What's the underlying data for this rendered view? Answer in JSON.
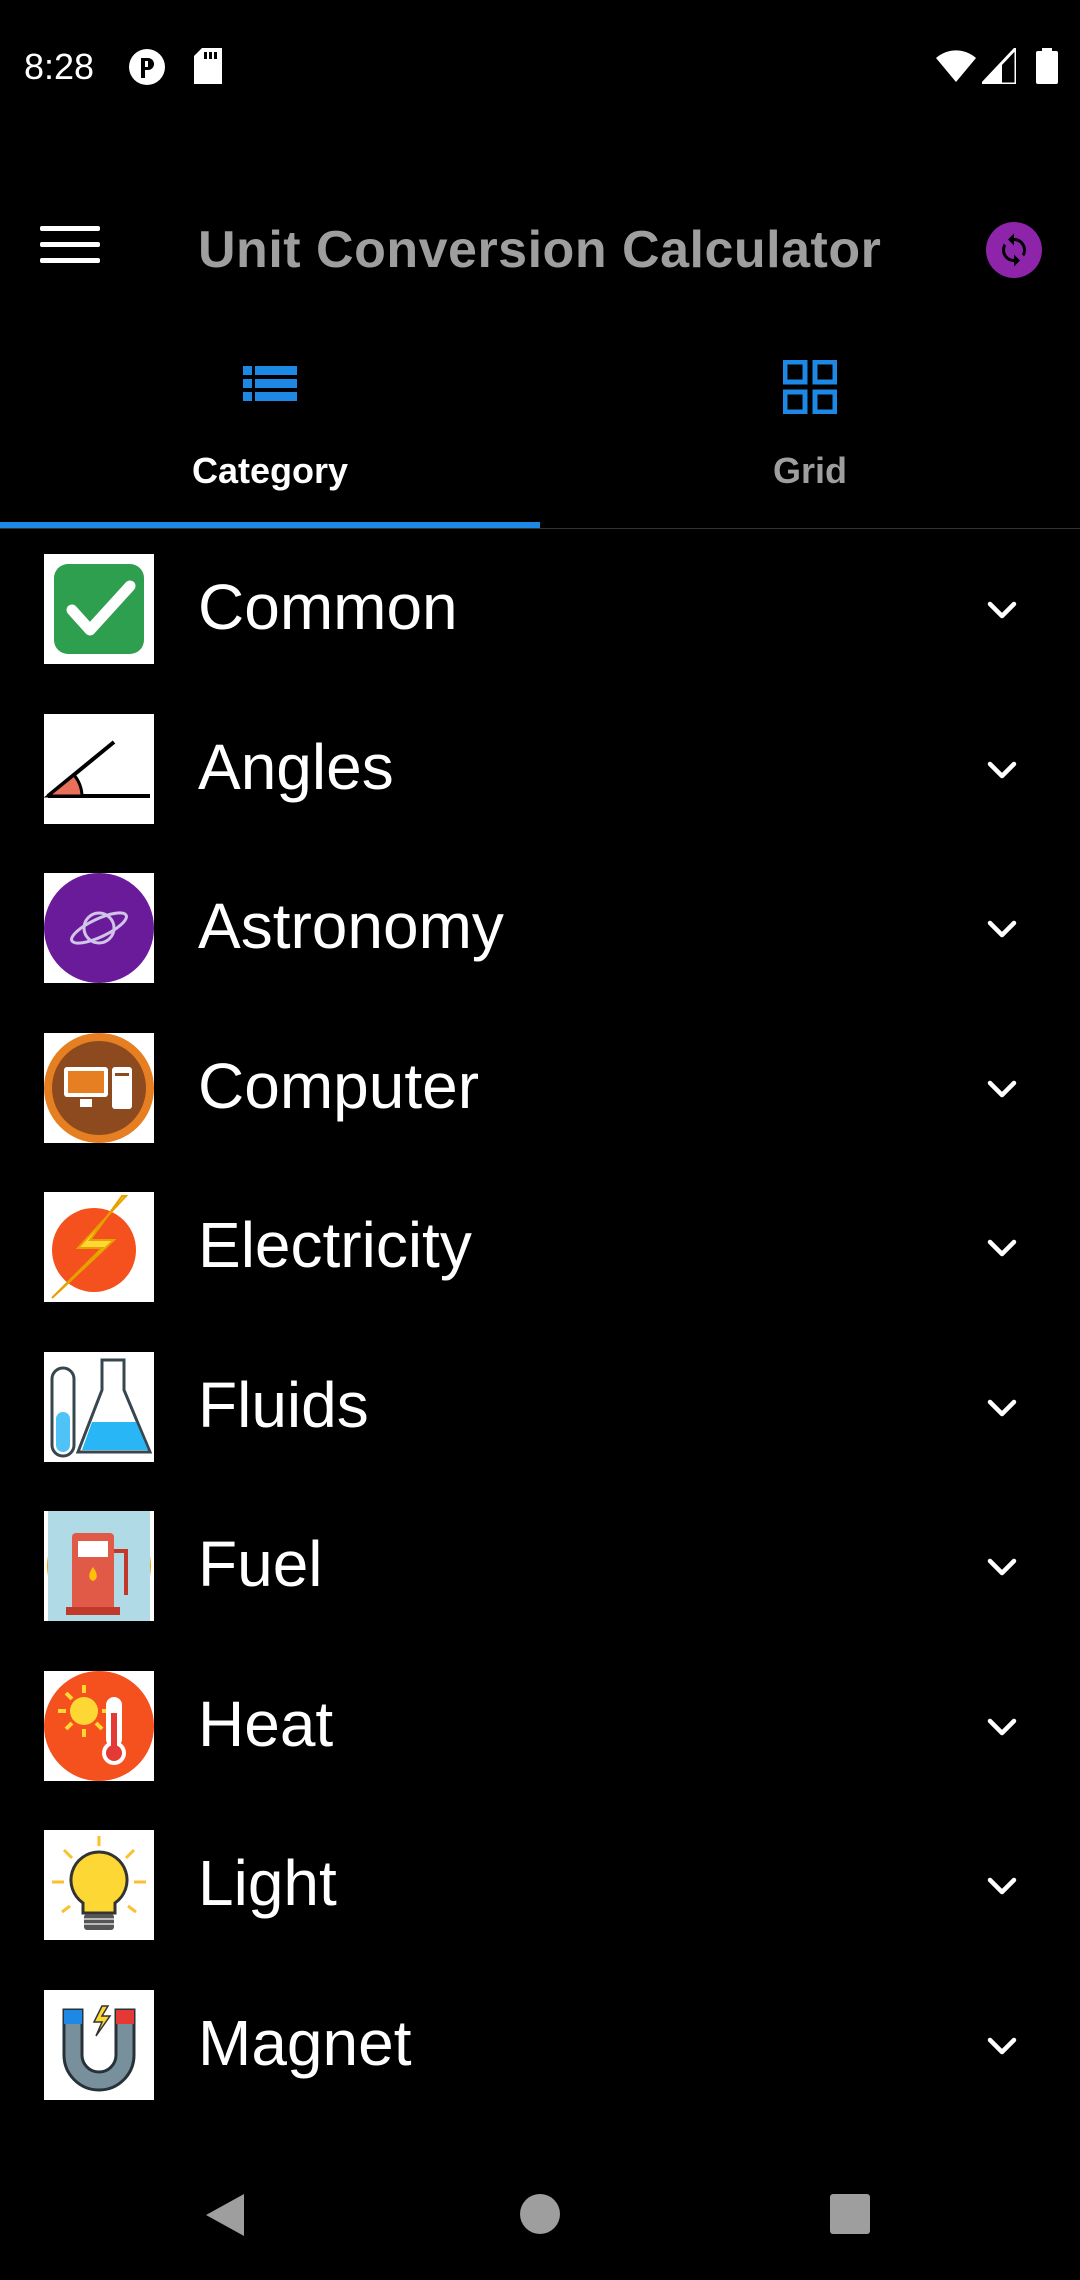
{
  "status_bar": {
    "time": "8:28",
    "icons": [
      "pocket-icon",
      "sd-card-icon",
      "wifi-icon",
      "signal-icon",
      "battery-icon"
    ]
  },
  "app_bar": {
    "title": "Unit Conversion Calculator",
    "accent_color": "#8e24aa"
  },
  "tabs": [
    {
      "label": "Category",
      "icon": "list-icon",
      "active": true
    },
    {
      "label": "Grid",
      "icon": "grid-icon",
      "active": false
    }
  ],
  "tab_color": "#1e88e5",
  "categories": [
    {
      "label": "Common",
      "icon": "checkmark-icon"
    },
    {
      "label": "Angles",
      "icon": "angle-icon"
    },
    {
      "label": "Astronomy",
      "icon": "planet-icon"
    },
    {
      "label": "Computer",
      "icon": "computer-icon"
    },
    {
      "label": "Electricity",
      "icon": "lightning-icon"
    },
    {
      "label": "Fluids",
      "icon": "flask-icon"
    },
    {
      "label": "Fuel",
      "icon": "fuel-pump-icon"
    },
    {
      "label": "Heat",
      "icon": "thermometer-icon"
    },
    {
      "label": "Light",
      "icon": "light-bulb-icon"
    },
    {
      "label": "Magnet",
      "icon": "magnet-icon"
    }
  ],
  "nav_bar": {
    "buttons": [
      "back-icon",
      "home-icon",
      "recents-icon"
    ]
  }
}
